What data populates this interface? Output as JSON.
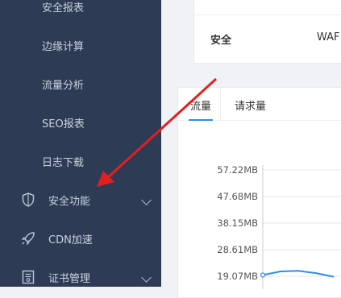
{
  "sidebar": {
    "sub_items": [
      {
        "label": "安全报表"
      },
      {
        "label": "边缘计算"
      },
      {
        "label": "流量分析"
      },
      {
        "label": "SEO报表"
      },
      {
        "label": "日志下载"
      }
    ],
    "top_items": [
      {
        "label": "安全功能",
        "icon": "shield-icon",
        "has_chevron": true
      },
      {
        "label": "CDN加速",
        "icon": "rocket-icon",
        "has_chevron": false
      },
      {
        "label": "证书管理",
        "icon": "certificate-icon",
        "has_chevron": true
      }
    ]
  },
  "info_card": {
    "row_key": "安全",
    "row_value": "WAF"
  },
  "chart_card": {
    "tabs": [
      {
        "label": "流量",
        "active": true
      },
      {
        "label": "请求量",
        "active": false
      }
    ]
  },
  "chart_data": {
    "type": "line",
    "y_tick_labels": [
      "57.22MB",
      "47.68MB",
      "38.15MB",
      "28.61MB",
      "19.07MB"
    ],
    "y_ticks": [
      57.22,
      47.68,
      38.15,
      28.61,
      19.07
    ],
    "series": [
      {
        "values": [
          19.5,
          20.8,
          21.0,
          20.2,
          18.9
        ]
      }
    ]
  },
  "colors": {
    "sidebar_bg": "#2e3b55",
    "accent": "#2d8cf0",
    "line": "#2d8cf0",
    "arrow": "#e02020"
  }
}
